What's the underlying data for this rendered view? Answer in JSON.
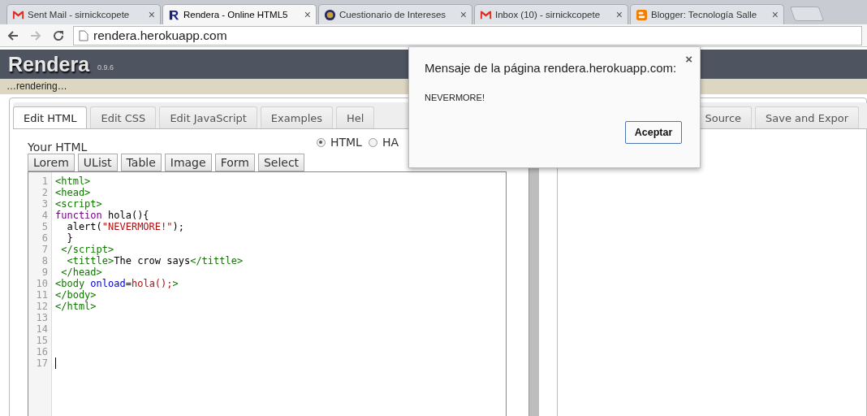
{
  "browser": {
    "tabs": [
      {
        "title": "Sent Mail - sirnickcopete",
        "selected": false
      },
      {
        "title": "Rendera - Online HTML5",
        "selected": true
      },
      {
        "title": "Cuestionario de Intereses",
        "selected": false
      },
      {
        "title": "Inbox (10) - sirnickcopete",
        "selected": false
      },
      {
        "title": "Blogger: Tecnología Salle",
        "selected": false
      }
    ],
    "close": "×",
    "url": "rendera.herokuapp.com"
  },
  "app": {
    "name": "Rendera",
    "version": "0.9.6",
    "status": "…rendering…"
  },
  "tabs": [
    {
      "label": "Edit HTML",
      "selected": true
    },
    {
      "label": "Edit CSS",
      "selected": false
    },
    {
      "label": "Edit JavaScript",
      "selected": false
    },
    {
      "label": "Examples",
      "selected": false
    },
    {
      "label": "Hel",
      "selected": false
    },
    {
      "label": "Source",
      "selected": false
    },
    {
      "label": "Save and Expor",
      "selected": false
    }
  ],
  "editor": {
    "label": "Your HTML",
    "modes": [
      {
        "label": "HTML",
        "selected": true
      },
      {
        "label": "HA",
        "selected": false
      }
    ],
    "snippets": [
      "Lorem",
      "UList",
      "Table",
      "Image",
      "Form",
      "Select"
    ],
    "lines": [
      {
        "number": "1",
        "cursor": false,
        "tokens": [
          {
            "kind": "tag",
            "text": "<html>"
          }
        ]
      },
      {
        "number": "2",
        "cursor": false,
        "tokens": [
          {
            "kind": "tag",
            "text": "<head>"
          }
        ]
      },
      {
        "number": "3",
        "cursor": false,
        "tokens": [
          {
            "kind": "tag",
            "text": "<script>"
          }
        ]
      },
      {
        "number": "4",
        "cursor": false,
        "tokens": [
          {
            "kind": "keyword",
            "text": "function"
          },
          {
            "kind": "text",
            "text": " hola(){"
          }
        ]
      },
      {
        "number": "5",
        "cursor": false,
        "tokens": [
          {
            "kind": "text",
            "text": "  alert("
          },
          {
            "kind": "string",
            "text": "\"NEVERMORE!\""
          },
          {
            "kind": "text",
            "text": ");"
          }
        ]
      },
      {
        "number": "6",
        "cursor": false,
        "tokens": [
          {
            "kind": "text",
            "text": "  }"
          }
        ]
      },
      {
        "number": "7",
        "cursor": false,
        "tokens": [
          {
            "kind": "tag",
            "text": " </script>"
          }
        ]
      },
      {
        "number": "8",
        "cursor": false,
        "tokens": [
          {
            "kind": "tag",
            "text": "  <tittle>"
          },
          {
            "kind": "text",
            "text": "The crow says"
          },
          {
            "kind": "tag",
            "text": "</tittle>"
          }
        ]
      },
      {
        "number": "9",
        "cursor": false,
        "tokens": [
          {
            "kind": "tag",
            "text": " </head>"
          }
        ]
      },
      {
        "number": "10",
        "cursor": false,
        "tokens": [
          {
            "kind": "tag",
            "text": "<body "
          },
          {
            "kind": "attr",
            "text": "onload"
          },
          {
            "kind": "text",
            "text": "="
          },
          {
            "kind": "string",
            "text": "hola();"
          },
          {
            "kind": "tag",
            "text": ">"
          }
        ]
      },
      {
        "number": "11",
        "cursor": false,
        "tokens": [
          {
            "kind": "tag",
            "text": "</body>"
          }
        ]
      },
      {
        "number": "12",
        "cursor": false,
        "tokens": [
          {
            "kind": "tag",
            "text": "</html>"
          }
        ]
      },
      {
        "number": "13",
        "cursor": false
      },
      {
        "number": "14",
        "cursor": false
      },
      {
        "number": "15",
        "cursor": false
      },
      {
        "number": "16",
        "cursor": false
      },
      {
        "number": "17",
        "cursor": true
      }
    ]
  },
  "dialog": {
    "title": "Mensaje de la página rendera.herokuapp.com:",
    "close": "×",
    "message": "NEVERMORE!",
    "button": "Aceptar"
  }
}
